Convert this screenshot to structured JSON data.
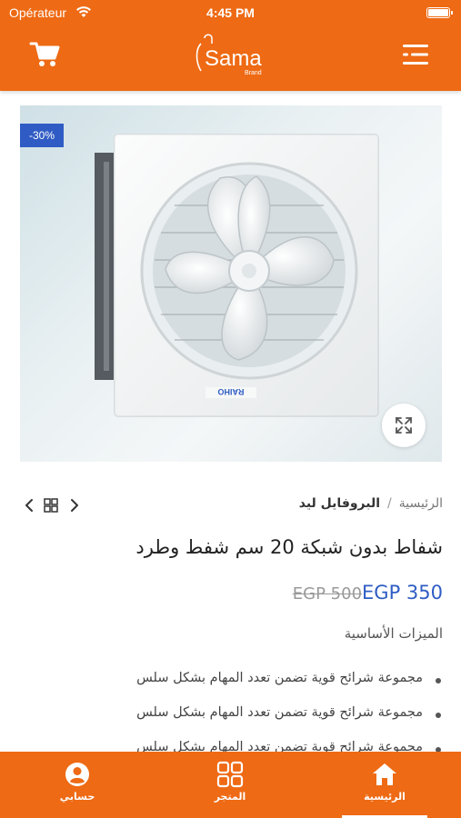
{
  "status_bar": {
    "carrier": "Opérateur",
    "time": "4:45 PM"
  },
  "header": {
    "logo_text": "Sama",
    "logo_sub": "Brand",
    "cart_icon": "cart-icon",
    "menu_icon": "menu-icon"
  },
  "product": {
    "discount_badge": "-30%",
    "brand_on_fan": "RAIHO",
    "breadcrumb": {
      "home": "الرئيسية",
      "separator": "/",
      "current": "البروفايل ليد"
    },
    "title": "شفاط بدون شبكة 20 سم شفط وطرد",
    "price_current": "EGP 350",
    "price_original": "EGP 500",
    "features_title": "الميزات الأساسية",
    "features": [
      "مجموعة شرائح قوية تضمن تعدد المهام بشكل سلس",
      "مجموعة شرائح قوية تضمن تعدد المهام بشكل سلس",
      "مجموعة شرائح قوية تضمن تعدد المهام بشكل سلس"
    ]
  },
  "tabbar": {
    "tabs": [
      {
        "label": "حسابي",
        "icon": "user-icon"
      },
      {
        "label": "المتجر",
        "icon": "grid-icon"
      },
      {
        "label": "الرئيسية",
        "icon": "home-icon",
        "active": true
      }
    ]
  },
  "colors": {
    "brand": "#ee6a14",
    "accent": "#2f5cc4"
  }
}
